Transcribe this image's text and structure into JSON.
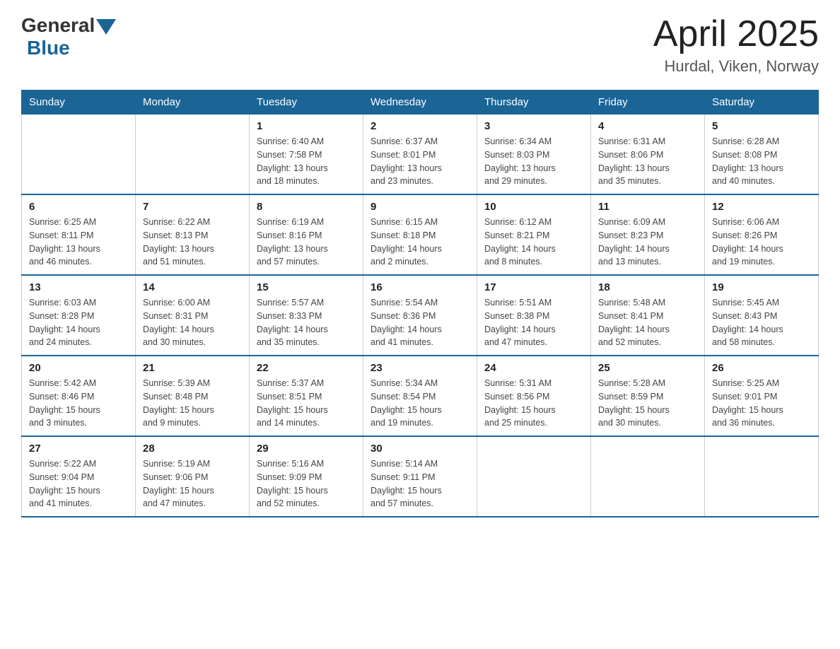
{
  "header": {
    "logo_general": "General",
    "logo_blue": "Blue",
    "month_title": "April 2025",
    "location": "Hurdal, Viken, Norway"
  },
  "weekdays": [
    "Sunday",
    "Monday",
    "Tuesday",
    "Wednesday",
    "Thursday",
    "Friday",
    "Saturday"
  ],
  "weeks": [
    [
      {
        "day": "",
        "info": ""
      },
      {
        "day": "",
        "info": ""
      },
      {
        "day": "1",
        "info": "Sunrise: 6:40 AM\nSunset: 7:58 PM\nDaylight: 13 hours\nand 18 minutes."
      },
      {
        "day": "2",
        "info": "Sunrise: 6:37 AM\nSunset: 8:01 PM\nDaylight: 13 hours\nand 23 minutes."
      },
      {
        "day": "3",
        "info": "Sunrise: 6:34 AM\nSunset: 8:03 PM\nDaylight: 13 hours\nand 29 minutes."
      },
      {
        "day": "4",
        "info": "Sunrise: 6:31 AM\nSunset: 8:06 PM\nDaylight: 13 hours\nand 35 minutes."
      },
      {
        "day": "5",
        "info": "Sunrise: 6:28 AM\nSunset: 8:08 PM\nDaylight: 13 hours\nand 40 minutes."
      }
    ],
    [
      {
        "day": "6",
        "info": "Sunrise: 6:25 AM\nSunset: 8:11 PM\nDaylight: 13 hours\nand 46 minutes."
      },
      {
        "day": "7",
        "info": "Sunrise: 6:22 AM\nSunset: 8:13 PM\nDaylight: 13 hours\nand 51 minutes."
      },
      {
        "day": "8",
        "info": "Sunrise: 6:19 AM\nSunset: 8:16 PM\nDaylight: 13 hours\nand 57 minutes."
      },
      {
        "day": "9",
        "info": "Sunrise: 6:15 AM\nSunset: 8:18 PM\nDaylight: 14 hours\nand 2 minutes."
      },
      {
        "day": "10",
        "info": "Sunrise: 6:12 AM\nSunset: 8:21 PM\nDaylight: 14 hours\nand 8 minutes."
      },
      {
        "day": "11",
        "info": "Sunrise: 6:09 AM\nSunset: 8:23 PM\nDaylight: 14 hours\nand 13 minutes."
      },
      {
        "day": "12",
        "info": "Sunrise: 6:06 AM\nSunset: 8:26 PM\nDaylight: 14 hours\nand 19 minutes."
      }
    ],
    [
      {
        "day": "13",
        "info": "Sunrise: 6:03 AM\nSunset: 8:28 PM\nDaylight: 14 hours\nand 24 minutes."
      },
      {
        "day": "14",
        "info": "Sunrise: 6:00 AM\nSunset: 8:31 PM\nDaylight: 14 hours\nand 30 minutes."
      },
      {
        "day": "15",
        "info": "Sunrise: 5:57 AM\nSunset: 8:33 PM\nDaylight: 14 hours\nand 35 minutes."
      },
      {
        "day": "16",
        "info": "Sunrise: 5:54 AM\nSunset: 8:36 PM\nDaylight: 14 hours\nand 41 minutes."
      },
      {
        "day": "17",
        "info": "Sunrise: 5:51 AM\nSunset: 8:38 PM\nDaylight: 14 hours\nand 47 minutes."
      },
      {
        "day": "18",
        "info": "Sunrise: 5:48 AM\nSunset: 8:41 PM\nDaylight: 14 hours\nand 52 minutes."
      },
      {
        "day": "19",
        "info": "Sunrise: 5:45 AM\nSunset: 8:43 PM\nDaylight: 14 hours\nand 58 minutes."
      }
    ],
    [
      {
        "day": "20",
        "info": "Sunrise: 5:42 AM\nSunset: 8:46 PM\nDaylight: 15 hours\nand 3 minutes."
      },
      {
        "day": "21",
        "info": "Sunrise: 5:39 AM\nSunset: 8:48 PM\nDaylight: 15 hours\nand 9 minutes."
      },
      {
        "day": "22",
        "info": "Sunrise: 5:37 AM\nSunset: 8:51 PM\nDaylight: 15 hours\nand 14 minutes."
      },
      {
        "day": "23",
        "info": "Sunrise: 5:34 AM\nSunset: 8:54 PM\nDaylight: 15 hours\nand 19 minutes."
      },
      {
        "day": "24",
        "info": "Sunrise: 5:31 AM\nSunset: 8:56 PM\nDaylight: 15 hours\nand 25 minutes."
      },
      {
        "day": "25",
        "info": "Sunrise: 5:28 AM\nSunset: 8:59 PM\nDaylight: 15 hours\nand 30 minutes."
      },
      {
        "day": "26",
        "info": "Sunrise: 5:25 AM\nSunset: 9:01 PM\nDaylight: 15 hours\nand 36 minutes."
      }
    ],
    [
      {
        "day": "27",
        "info": "Sunrise: 5:22 AM\nSunset: 9:04 PM\nDaylight: 15 hours\nand 41 minutes."
      },
      {
        "day": "28",
        "info": "Sunrise: 5:19 AM\nSunset: 9:06 PM\nDaylight: 15 hours\nand 47 minutes."
      },
      {
        "day": "29",
        "info": "Sunrise: 5:16 AM\nSunset: 9:09 PM\nDaylight: 15 hours\nand 52 minutes."
      },
      {
        "day": "30",
        "info": "Sunrise: 5:14 AM\nSunset: 9:11 PM\nDaylight: 15 hours\nand 57 minutes."
      },
      {
        "day": "",
        "info": ""
      },
      {
        "day": "",
        "info": ""
      },
      {
        "day": "",
        "info": ""
      }
    ]
  ]
}
